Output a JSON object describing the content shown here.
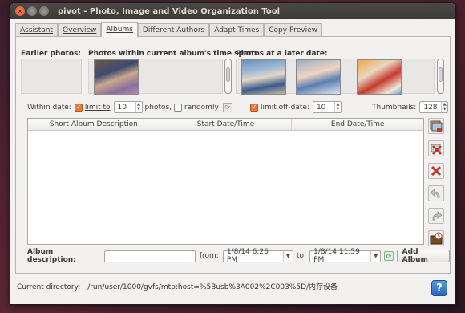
{
  "window": {
    "title": "pivot - Photo, Image and Video Organization Tool"
  },
  "tabs": [
    {
      "label": "Assistant"
    },
    {
      "label": "Overview"
    },
    {
      "label": "Albums"
    },
    {
      "label": "Different Authors"
    },
    {
      "label": "Adapt Times"
    },
    {
      "label": "Copy Preview"
    }
  ],
  "photos": {
    "earlier_label": "Earlier photos:",
    "within_label": "Photos within current album's time span:",
    "later_label": "Photos at a later date:"
  },
  "options": {
    "within_date_label": "Within date:",
    "limit_to_label": "limit to",
    "limit_to_value": "10",
    "photos_label": "photos,",
    "randomly_label": "randomly",
    "limit_offdate_label": "limit off-date:",
    "limit_offdate_value": "10",
    "thumbnails_label": "Thumbnails:",
    "thumbnails_value": "128"
  },
  "table": {
    "columns": [
      "Short Album Description",
      "Start Date/Time",
      "End Date/Time"
    ]
  },
  "bottom": {
    "album_description_label": "Album description:",
    "album_description_value": "",
    "from_label": "from:",
    "from_value": "1/8/14 6:26 PM",
    "to_label": "to:",
    "to_value": "1/8/14 11:59 PM",
    "add_album_label": "Add Album"
  },
  "footer": {
    "current_directory_label": "Current directory:",
    "current_directory_value": "/run/user/1000/gvfs/mtp:host=%5Busb%3A002%2C003%5D/内存设备"
  },
  "colors": {
    "accent": "#e97a3a",
    "help_blue": "#2a66b8"
  }
}
